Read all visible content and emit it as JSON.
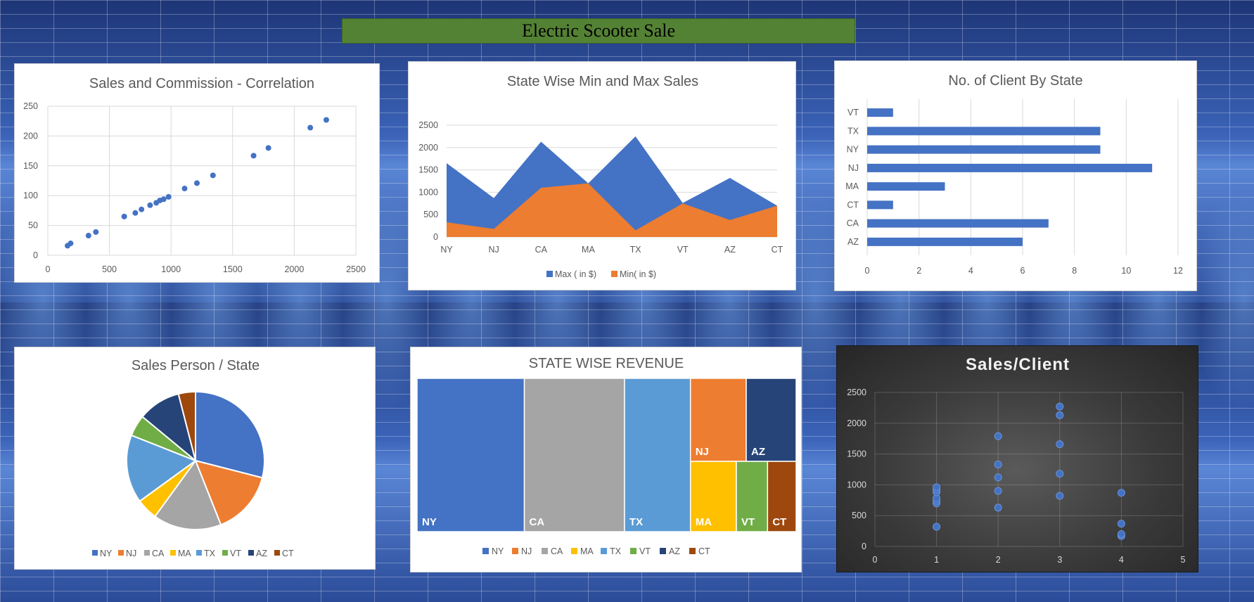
{
  "dashboard": {
    "title": "Electric Scooter Sale"
  },
  "colors": {
    "blue": "#4472C4",
    "orange": "#ED7D31",
    "gray": "#A5A5A5",
    "gold": "#FFC000",
    "lightblue": "#5B9BD5",
    "green": "#70AD47",
    "navy": "#264478",
    "brown": "#9E480E",
    "banner": "#548235"
  },
  "chart_data": [
    {
      "id": "scatter1",
      "type": "scatter",
      "title": "Sales and Commission  - Correlation",
      "xlim": [
        0,
        2500
      ],
      "xticks": [
        0,
        500,
        1000,
        1500,
        2000,
        2500
      ],
      "ylim": [
        0,
        250
      ],
      "yticks": [
        0,
        50,
        100,
        150,
        200,
        250
      ],
      "grid": true,
      "points": [
        [
          160,
          16
        ],
        [
          185,
          20
        ],
        [
          330,
          33
        ],
        [
          390,
          39
        ],
        [
          620,
          65
        ],
        [
          710,
          71
        ],
        [
          760,
          77
        ],
        [
          830,
          84
        ],
        [
          880,
          88
        ],
        [
          910,
          92
        ],
        [
          940,
          94
        ],
        [
          980,
          98
        ],
        [
          1110,
          112
        ],
        [
          1210,
          121
        ],
        [
          1340,
          134
        ],
        [
          1670,
          167
        ],
        [
          1790,
          180
        ],
        [
          2130,
          214
        ],
        [
          2260,
          227
        ]
      ]
    },
    {
      "id": "area1",
      "type": "area",
      "title": "State Wise Min and Max Sales",
      "categories": [
        "NY",
        "NJ",
        "CA",
        "MA",
        "TX",
        "VT",
        "AZ",
        "CT"
      ],
      "ylim": [
        0,
        2500
      ],
      "yticks": [
        0,
        500,
        1000,
        1500,
        2000,
        2500
      ],
      "grid": true,
      "legend": "bottom",
      "series": [
        {
          "name": "Max ( in $)",
          "values": [
            1650,
            870,
            2130,
            1200,
            2250,
            760,
            1320,
            700
          ]
        },
        {
          "name": "Min( in $)",
          "values": [
            330,
            180,
            1100,
            1200,
            150,
            750,
            380,
            700
          ]
        }
      ]
    },
    {
      "id": "hbar1",
      "type": "bar",
      "orientation": "horizontal",
      "title": "No. of Client By State",
      "categories": [
        "VT",
        "TX",
        "NY",
        "NJ",
        "MA",
        "CT",
        "CA",
        "AZ"
      ],
      "values": [
        1,
        9,
        9,
        11,
        3,
        1,
        7,
        6
      ],
      "xlim": [
        0,
        12
      ],
      "xticks": [
        0,
        2,
        4,
        6,
        8,
        10,
        12
      ],
      "grid": true
    },
    {
      "id": "pie1",
      "type": "pie",
      "title": "Sales Person / State",
      "categories": [
        "NY",
        "NJ",
        "CA",
        "MA",
        "TX",
        "VT",
        "AZ",
        "CT"
      ],
      "values": [
        29,
        15,
        16,
        5,
        16,
        5,
        10,
        4
      ],
      "legend": "bottom"
    },
    {
      "id": "treemap1",
      "type": "treemap",
      "title": "STATE WISE REVENUE",
      "categories": [
        "NY",
        "NJ",
        "CA",
        "MA",
        "TX",
        "VT",
        "AZ",
        "CT"
      ],
      "values": [
        27,
        7.6,
        25.2,
        5.3,
        16.6,
        3.6,
        6.8,
        3.3
      ],
      "legend": "bottom"
    },
    {
      "id": "scatter2",
      "type": "scatter",
      "title": "Sales/Client",
      "xlim": [
        0,
        5
      ],
      "xticks": [
        0,
        1,
        2,
        3,
        4,
        5
      ],
      "ylim": [
        0,
        2500
      ],
      "yticks": [
        0,
        500,
        1000,
        1500,
        2000,
        2500
      ],
      "grid": true,
      "theme": "dark",
      "points": [
        [
          1,
          320
        ],
        [
          1,
          700
        ],
        [
          1,
          740
        ],
        [
          1,
          780
        ],
        [
          1,
          880
        ],
        [
          1,
          920
        ],
        [
          1,
          960
        ],
        [
          2,
          630
        ],
        [
          2,
          900
        ],
        [
          2,
          1120
        ],
        [
          2,
          1330
        ],
        [
          2,
          1790
        ],
        [
          3,
          820
        ],
        [
          3,
          1180
        ],
        [
          3,
          1660
        ],
        [
          3,
          2130
        ],
        [
          3,
          2270
        ],
        [
          4,
          170
        ],
        [
          4,
          200
        ],
        [
          4,
          370
        ],
        [
          4,
          870
        ]
      ]
    }
  ]
}
